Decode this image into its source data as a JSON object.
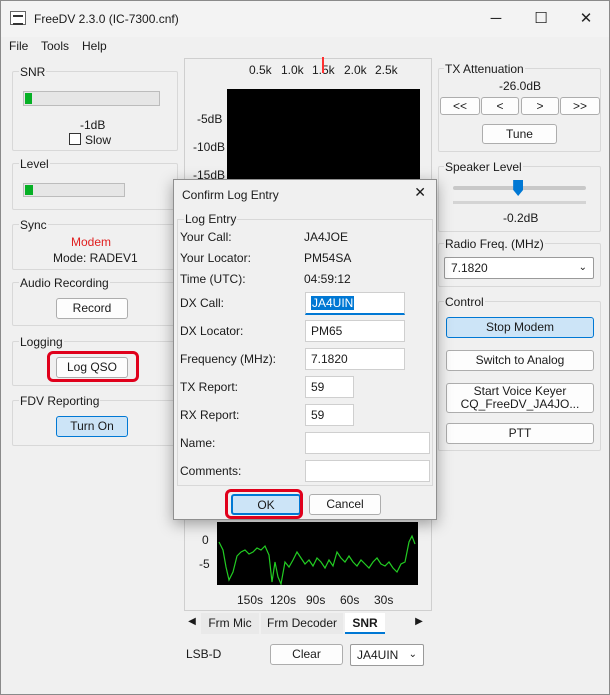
{
  "window": {
    "title": "FreeDV 2.3.0 (IC-7300.cnf)",
    "minimize": "─",
    "maximize": "☐",
    "close": "✕"
  },
  "menu": [
    "File",
    "Tools",
    "Help"
  ],
  "snr": {
    "label": "SNR",
    "value": "-1dB",
    "slow": "Slow",
    "level_fraction": 0.05
  },
  "level": {
    "label": "Level",
    "level_fraction": 0.08
  },
  "sync": {
    "label": "Sync",
    "status": "Modem",
    "status_color": "#e02020",
    "mode": "Mode: RADEV1"
  },
  "audio": {
    "label": "Audio Recording",
    "record": "Record"
  },
  "logging": {
    "label": "Logging",
    "log_qso": "Log QSO"
  },
  "fdv": {
    "label": "FDV Reporting",
    "turn_on": "Turn On"
  },
  "spectrum": {
    "freq_ticks": [
      "0.5k",
      "1.0k",
      "1.5k",
      "2.0k",
      "2.5k"
    ],
    "db_ticks": [
      "-5dB",
      "-10dB",
      "-15dB"
    ],
    "lower_y_ticks": [
      "0",
      "-5"
    ],
    "time_ticks": [
      "150s",
      "120s",
      "90s",
      "60s",
      "30s"
    ]
  },
  "tabs": {
    "left_arrow": "◀",
    "right_arrow": "▶",
    "items": [
      "Frm Mic",
      "Frm Decoder",
      "SNR"
    ],
    "active": "SNR"
  },
  "bottom": {
    "mode": "LSB-D",
    "clear": "Clear",
    "callsign": "JA4UIN"
  },
  "tx_atten": {
    "label": "TX Attenuation",
    "value": "-26.0dB",
    "b1": "<<",
    "b2": "<",
    "b3": ">",
    "b4": ">>",
    "tune": "Tune"
  },
  "speaker": {
    "label": "Speaker Level",
    "value": "-0.2dB",
    "level_fraction": 0.49
  },
  "radio": {
    "label": "Radio Freq. (MHz)",
    "value": "7.1820"
  },
  "control": {
    "label": "Control",
    "stop": "Stop Modem",
    "analog": "Switch to Analog",
    "voice1": "Start Voice Keyer",
    "voice2": "CQ_FreeDV_JA4JO...",
    "ptt": "PTT"
  },
  "dialog": {
    "title": "Confirm Log Entry",
    "close": "✕",
    "group": "Log Entry",
    "your_call_label": "Your Call:",
    "your_call": "JA4JOE",
    "your_locator_label": "Your Locator:",
    "your_locator": "PM54SA",
    "time_label": "Time (UTC):",
    "time": "04:59:12",
    "dx_call_label": "DX Call:",
    "dx_call": "JA4UIN",
    "dx_locator_label": "DX Locator:",
    "dx_locator": "PM65",
    "freq_label": "Frequency (MHz):",
    "freq": "7.1820",
    "tx_report_label": "TX Report:",
    "tx_report": "59",
    "rx_report_label": "RX Report:",
    "rx_report": "59",
    "name_label": "Name:",
    "name": "",
    "comments_label": "Comments:",
    "comments": "",
    "ok": "OK",
    "cancel": "Cancel"
  },
  "colors": {
    "accent": "#0078d4",
    "annotation": "#e0001b",
    "level_green": "#06b025",
    "marker": "#ff3030"
  }
}
